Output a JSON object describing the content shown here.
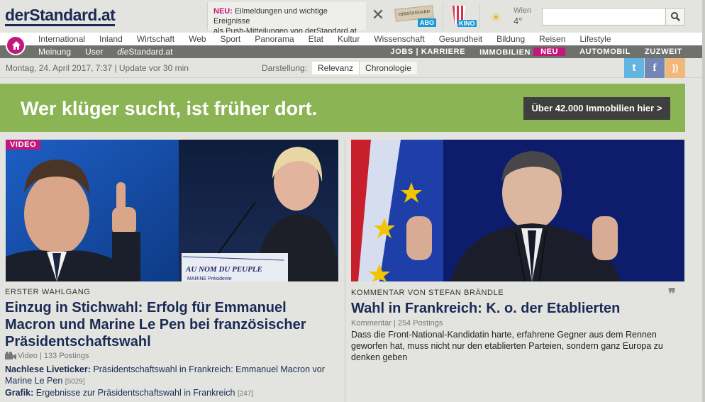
{
  "header": {
    "logo": "derStandard.at",
    "push_badge": "NEU:",
    "push_text_1": "Eilmeldungen und wichtige Ereignisse",
    "push_text_2": "als Push-Mitteilungen von derStandard.at",
    "abo_label": "ABO",
    "abo_paper": "DERSTANDARD",
    "kino_label": "KINO",
    "weather_city": "Wien",
    "weather_temp": "4°",
    "search_placeholder": ""
  },
  "nav": {
    "primary": [
      "International",
      "Inland",
      "Wirtschaft",
      "Web",
      "Sport",
      "Panorama",
      "Etat",
      "Kultur",
      "Wissenschaft",
      "Gesundheit",
      "Bildung",
      "Reisen",
      "Lifestyle"
    ],
    "secondary_left": {
      "meinung": "Meinung",
      "user": "User",
      "die_prefix": "die",
      "die_suffix": "Standard.at"
    },
    "secondary_right": {
      "jobs": "JOBS | KARRIERE",
      "immo": "IMMOBILIEN",
      "immo_badge": "NEU",
      "auto": "AUTOMOBIL",
      "zuzweit": "ZUZWEIT"
    }
  },
  "datebar": {
    "date": "Montag, 24. April 2017, 7:37 | Update vor 30 min",
    "darstellung": "Darstellung:",
    "relevanz": "Relevanz",
    "chronologie": "Chronologie"
  },
  "banner": {
    "text": "Wer klüger sucht, ist früher dort.",
    "button": "Über 42.000 Immobilien hier >"
  },
  "article1": {
    "badge": "VIDEO",
    "kicker": "ERSTER WAHLGANG",
    "headline": "Einzug in Stichwahl: Erfolg für Emmanuel Macron und Marine Le Pen bei französischer Präsidentschaftswahl",
    "meta": "Video | 133 Postings",
    "podium_text": "AU NOM DU PEUPLE",
    "podium_text_2": "MARINE Présidente",
    "related": [
      {
        "label": "Nachlese Liveticker:",
        "text": "Präsidentschaftswahl in Frankreich: Emmanuel Macron vor Marine Le Pen",
        "count": "[5029]"
      },
      {
        "label": "Grafik:",
        "text": "Ergebnisse zur Präsidentschaftswahl in Frankreich",
        "count": "[247]"
      }
    ]
  },
  "article2": {
    "kicker": "KOMMENTAR VON STEFAN BRÄNDLE",
    "headline": "Wahl in Frankreich: K. o. der Etablierten",
    "meta": "Kommentar | 254 Postings",
    "lead": "Dass die Front-National-Kandidatin harte, erfahrene Gegner aus dem Rennen geworfen hat, muss nicht nur den etablierten Parteien, sondern ganz Europa zu denken geben"
  },
  "social": {
    "twitter": "t",
    "facebook": "f",
    "rss": "))"
  },
  "colors": {
    "brand_navy": "#1a2a54",
    "accent_magenta": "#c4177b",
    "banner_green": "#8bb455",
    "nav_gray": "#6f716d"
  }
}
